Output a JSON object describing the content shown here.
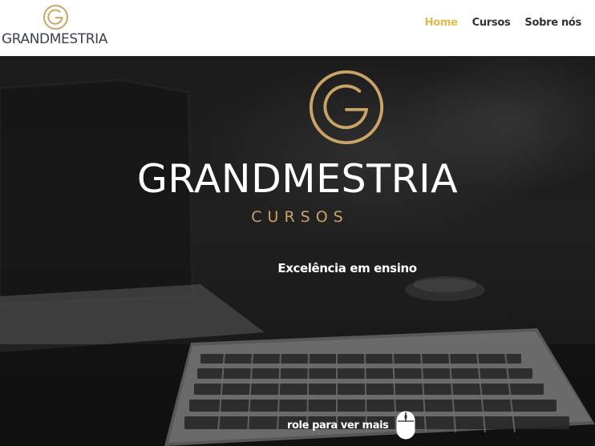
{
  "header": {
    "logo_text": "GRANDMESTRIA",
    "logo_icon": "grandmestria-g-logo-icon",
    "nav": [
      {
        "label": "Home",
        "active": true
      },
      {
        "label": "Cursos",
        "active": false
      },
      {
        "label": "Sobre nós",
        "active": false
      }
    ]
  },
  "hero": {
    "logo_icon": "grandmestria-g-logo-icon",
    "title": "GRANDMESTRIA",
    "subtitle": "CURSOS",
    "tagline": "Excelência em ensino",
    "scroll_hint": "role para ver mais",
    "scroll_icon": "mouse-icon"
  },
  "colors": {
    "accent_gold": "#c9a465",
    "nav_active": "#e8b94a",
    "nav_text": "#333333",
    "logo_text": "#3b4152",
    "hero_text": "#ffffff"
  }
}
